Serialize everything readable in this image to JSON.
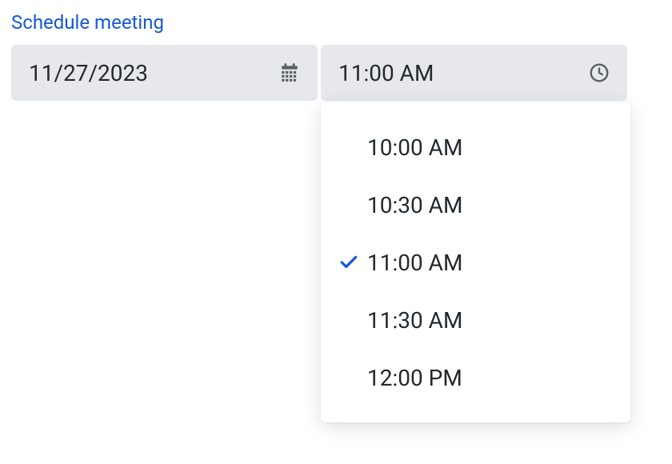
{
  "title": "Schedule meeting",
  "date_field": {
    "value": "11/27/2023"
  },
  "time_field": {
    "value": "11:00 AM"
  },
  "time_options": [
    {
      "label": "10:00 AM",
      "selected": false
    },
    {
      "label": "10:30 AM",
      "selected": false
    },
    {
      "label": "11:00 AM",
      "selected": true
    },
    {
      "label": "11:30 AM",
      "selected": false
    },
    {
      "label": "12:00 PM",
      "selected": false
    }
  ],
  "colors": {
    "accent": "#1558d6",
    "field_bg": "#e6e8ec",
    "text": "#24292e",
    "icon": "#5a6069"
  }
}
